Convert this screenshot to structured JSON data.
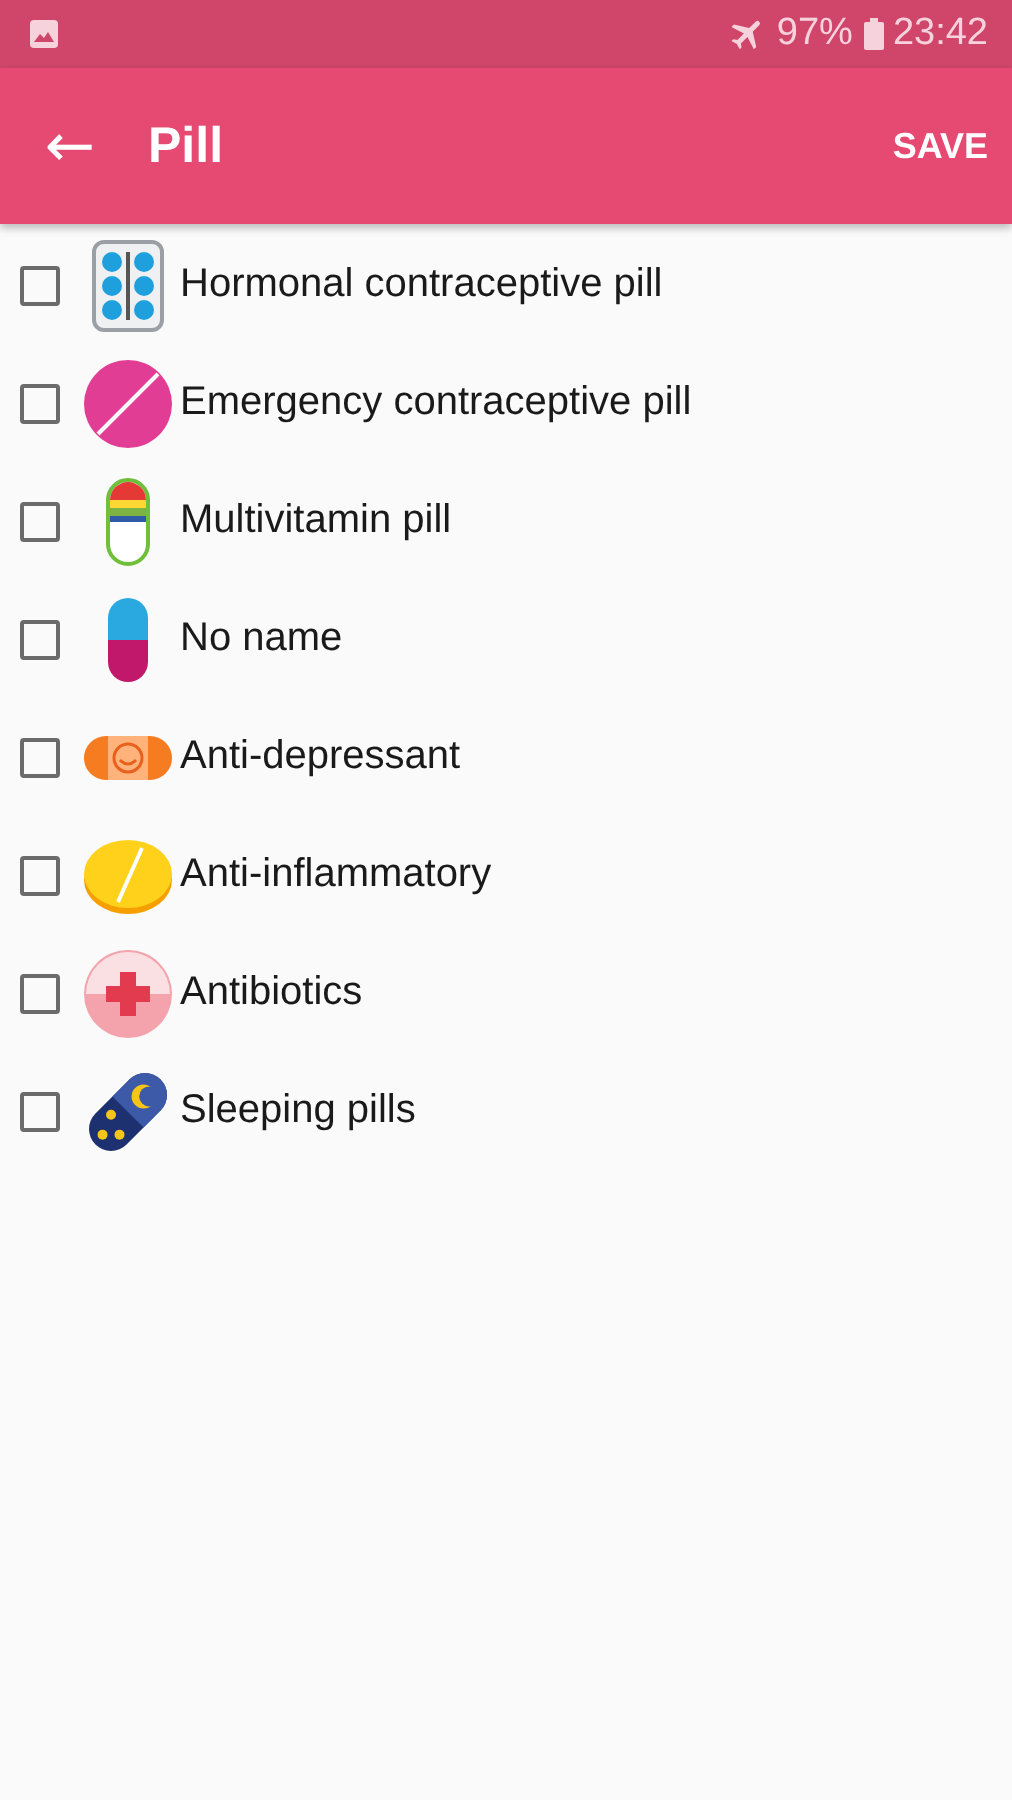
{
  "status_bar": {
    "battery": "97%",
    "time": "23:42"
  },
  "app_bar": {
    "back": "←",
    "title": "Pill",
    "action": "SAVE"
  },
  "pills": [
    {
      "name": "Hormonal contraceptive pill",
      "kind": "blister",
      "checked": false
    },
    {
      "name": "Emergency contraceptive pill",
      "kind": "pink-tablet",
      "checked": false
    },
    {
      "name": "Multivitamin pill",
      "kind": "rainbow-capsule",
      "checked": false
    },
    {
      "name": "No name",
      "kind": "capsule",
      "checked": false
    },
    {
      "name": "Anti-depressant",
      "kind": "smiley",
      "checked": false
    },
    {
      "name": "Anti-inflammatory",
      "kind": "yellow-tablet",
      "checked": false
    },
    {
      "name": "Antibiotics",
      "kind": "cross",
      "checked": false
    },
    {
      "name": "Sleeping pills",
      "kind": "night",
      "checked": false
    }
  ]
}
